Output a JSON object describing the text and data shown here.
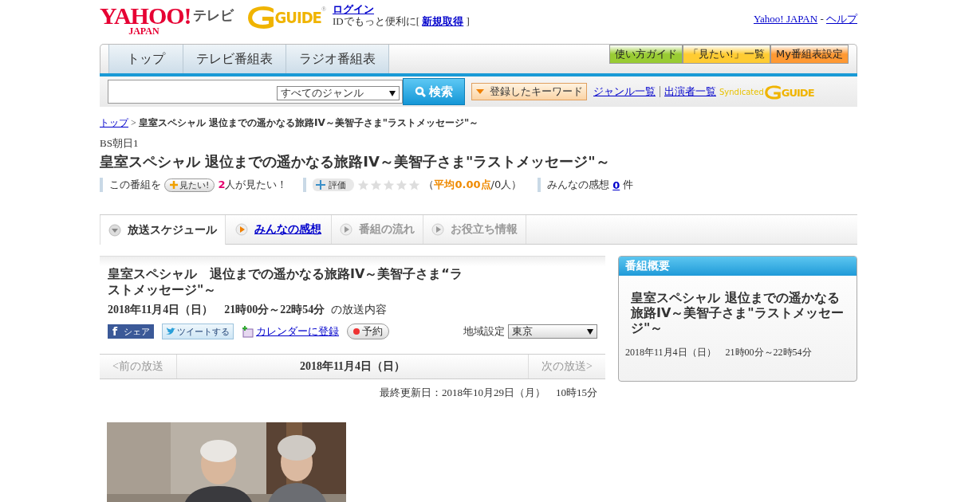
{
  "header": {
    "yahoo_logo": {
      "main": "YAHOO!",
      "sub": "JAPAN",
      "suffix": "テレビ"
    },
    "gguide_logo": {
      "text": "GUIDE",
      "mark": "®"
    },
    "login": "ログイン",
    "login_note": "IDでもっと便利に[",
    "signup": "新規取得",
    "login_note_end": "]",
    "links": [
      "Yahoo! JAPAN",
      "ヘルプ"
    ],
    "links_sep": "-"
  },
  "nav": {
    "tabs": [
      {
        "label": "トップ"
      },
      {
        "label": "テレビ番組表"
      },
      {
        "label": "ラジオ番組表"
      }
    ],
    "buttons": [
      {
        "label": "使い方ガイド",
        "color": "#99cc33"
      },
      {
        "label": "「見たい!」一覧",
        "color": "#ffcc33"
      },
      {
        "label": "My番組表設定",
        "color": "#ff9933"
      }
    ]
  },
  "search": {
    "genre": "すべてのジャンル",
    "button": "検索",
    "keyword_button": "登録したキーワード",
    "links": [
      "ジャンル一覧",
      "出演者一覧"
    ],
    "syndicated": "Syndicated",
    "syndicated_logo": "GUIDE"
  },
  "breadcrumb": {
    "home": "トップ",
    "sep": ">",
    "current": "皇室スペシャル 退位までの遥かなる旅路IV～美智子さま\"ラストメッセージ\"～"
  },
  "program": {
    "channel": "BS朝日1",
    "title": "皇室スペシャル 退位までの遥かなる旅路IV～美智子さま\"ラストメッセージ\"～",
    "want_prefix": "この番組を",
    "want_button": "見たい!",
    "want_count": "2",
    "want_suffix": "人が見たい！",
    "rate_button": "評価",
    "stars": 0,
    "rating_open": "（",
    "rating_avg": "平均0.00点",
    "rating_rest": "/0人）",
    "comments_label": "みんなの感想",
    "comments_count": "0",
    "comments_unit": "件"
  },
  "tabs": [
    {
      "label": "放送スケジュール",
      "selected": true,
      "disabled": false
    },
    {
      "label": "みんなの感想",
      "selected": false,
      "disabled": false
    },
    {
      "label": "番組の流れ",
      "selected": false,
      "disabled": true
    },
    {
      "label": "お役立ち情報",
      "selected": false,
      "disabled": true
    }
  ],
  "broadcast": {
    "title": "皇室スペシャル　退位までの遥かなる旅路IV～美智子さま“ラストメッセージ\"～",
    "datetime": "2018年11月4日（日）　21時00分～22時54分",
    "datetime_suffix": "の放送内容",
    "share_icon": "f",
    "share": "シェア",
    "tweet": "ツイートする",
    "calendar": "カレンダーに登録",
    "reserve": "予約",
    "region_label": "地域設定",
    "region": "東京",
    "prev": "<前の放送",
    "date": "2018年11月4日（日）",
    "next": "次の放送>",
    "updated": "最終更新日：2018年10月29日（月）　10時15分"
  },
  "summary": {
    "heading": "番組概要",
    "title": "皇室スペシャル 退位までの遥かなる旅路IV～美智子さま\"ラストメッセージ\"～",
    "datetime": "2018年11月4日（日）　21時00分～22時54分"
  }
}
